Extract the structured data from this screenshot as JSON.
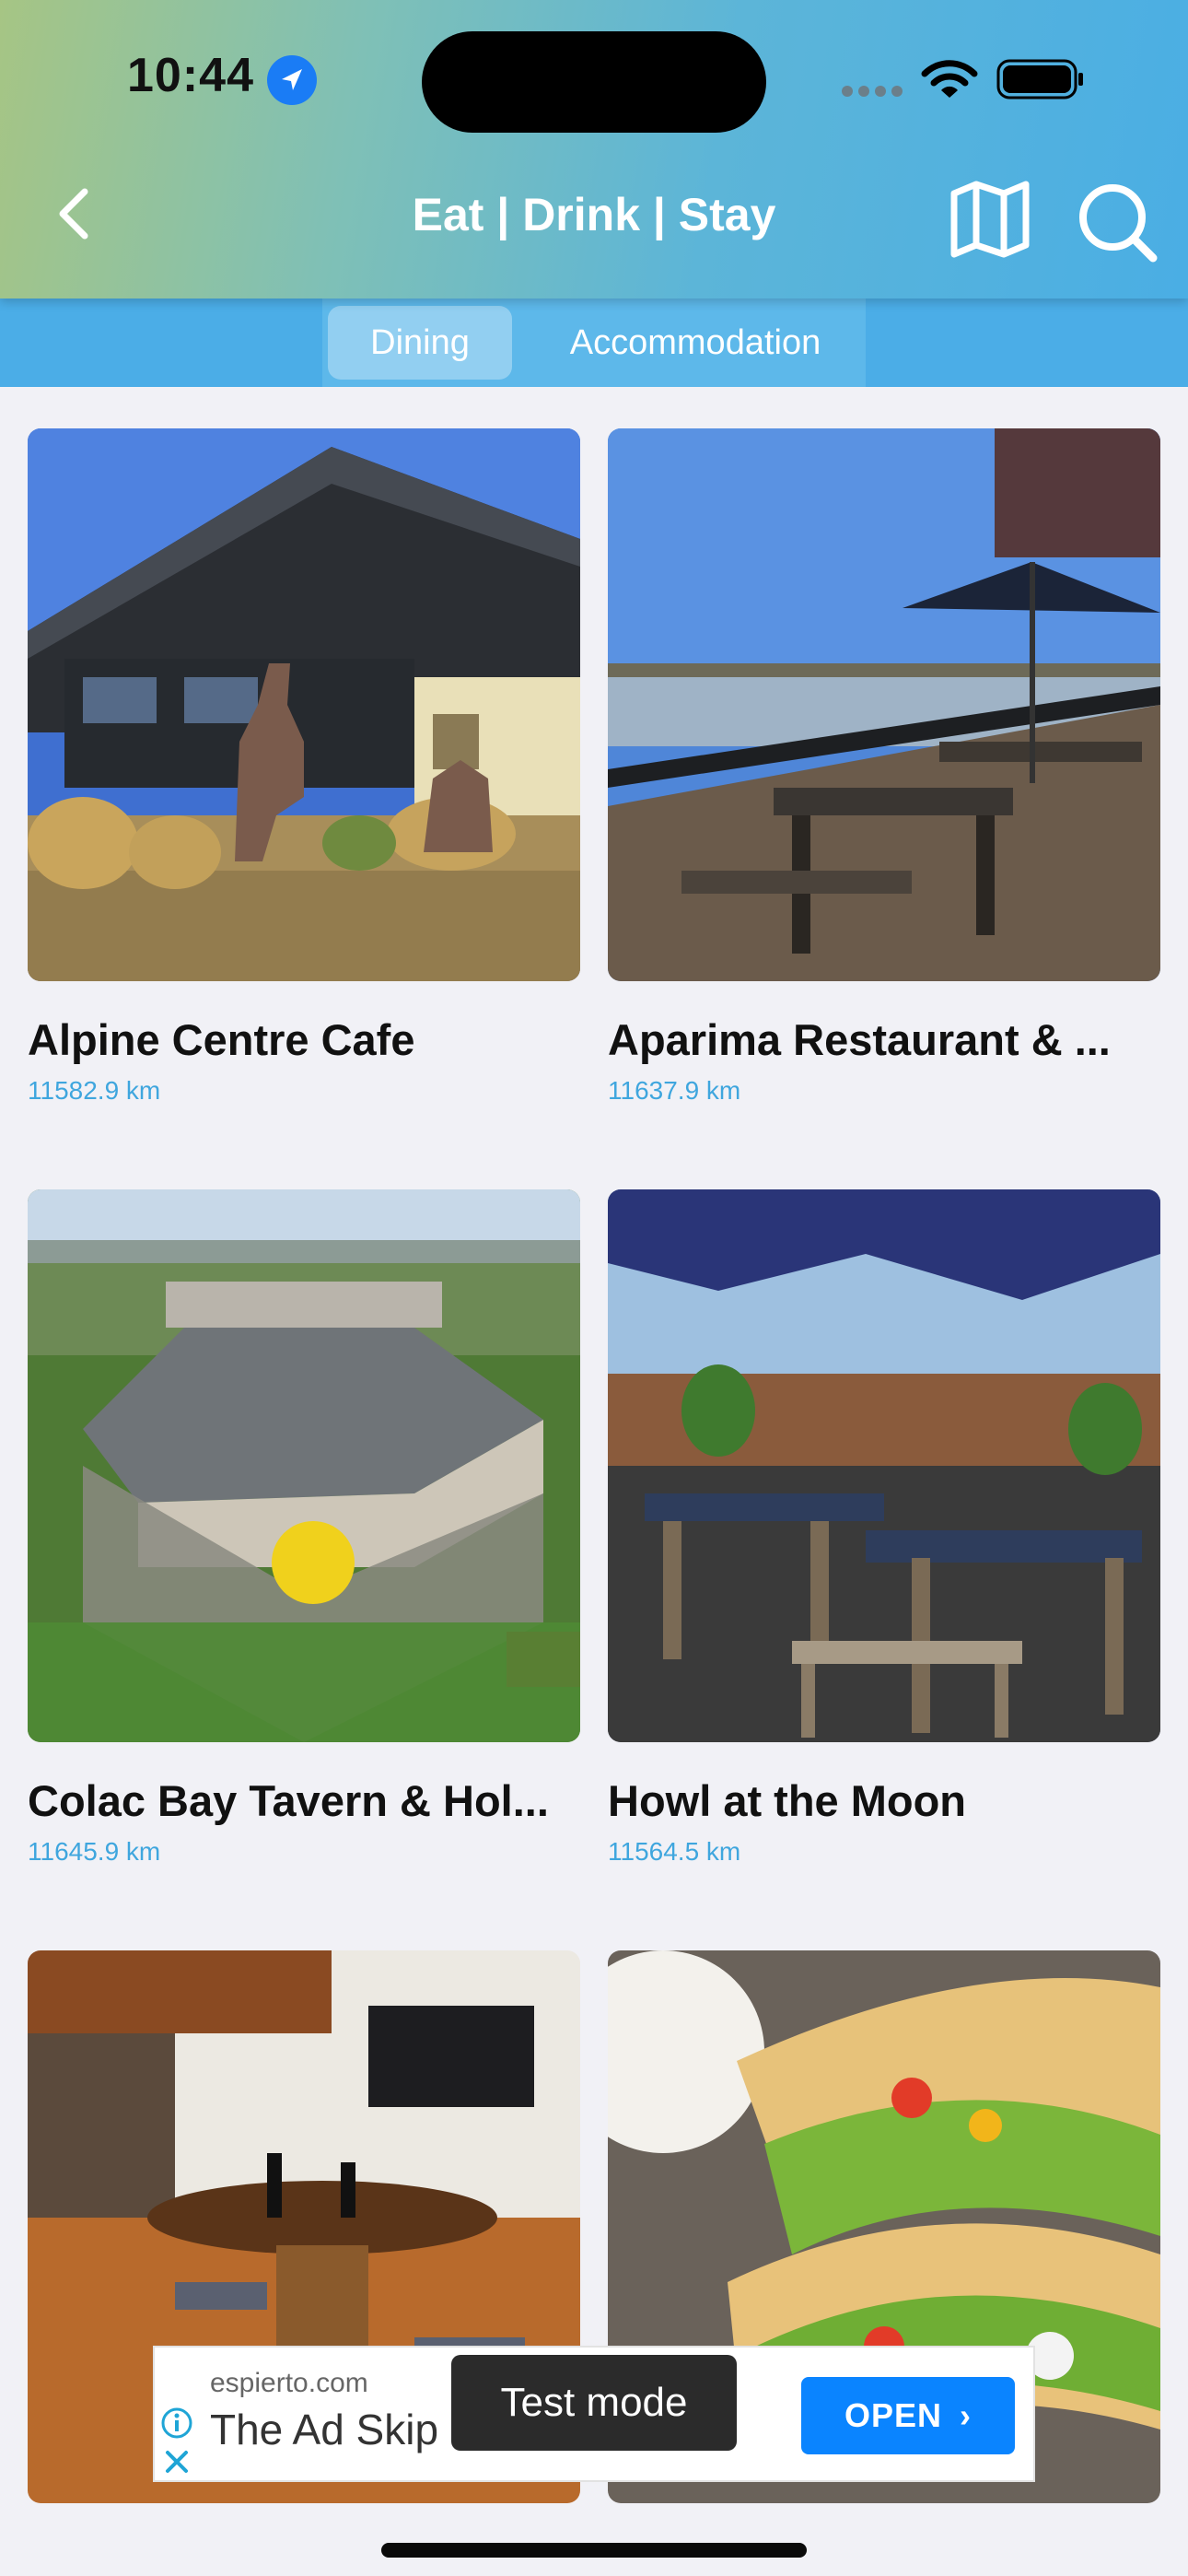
{
  "status_bar": {
    "time": "10:44"
  },
  "header": {
    "title": "Eat | Drink | Stay"
  },
  "tabs": {
    "dining": "Dining",
    "accommodation": "Accommodation",
    "selected": "Dining"
  },
  "listings": [
    {
      "name": "Alpine Centre Cafe",
      "distance": "11582.9 km"
    },
    {
      "name": "Aparima Restaurant & ...",
      "distance": "11637.9 km"
    },
    {
      "name": "Colac Bay Tavern & Hol...",
      "distance": "11645.9 km"
    },
    {
      "name": "Howl at the Moon",
      "distance": "11564.5 km"
    }
  ],
  "ad": {
    "domain": "espierto.com",
    "title": "The Ad Skip",
    "open_label": "OPEN",
    "test_mode": "Test mode"
  },
  "colors": {
    "accent": "#4bade7",
    "distance": "#3fa6de",
    "ad_button": "#0a84ff"
  }
}
